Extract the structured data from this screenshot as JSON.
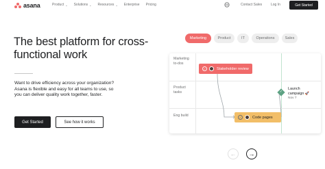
{
  "nav": {
    "logo_text": "asana",
    "links": [
      {
        "label": "Product",
        "has_dropdown": true
      },
      {
        "label": "Solutions",
        "has_dropdown": true
      },
      {
        "label": "Resources",
        "has_dropdown": true
      },
      {
        "label": "Enterprise",
        "has_dropdown": false
      },
      {
        "label": "Pricing",
        "has_dropdown": false
      }
    ],
    "globe_icon": "globe-icon",
    "contact_sales": "Contact Sales",
    "log_in": "Log In",
    "get_started": "Get Started"
  },
  "hero": {
    "headline": "The best platform for cross-functional work",
    "description": "Want to drive efficiency across your organization? Asana is flexible and easy for all teams to use, so you can deliver quality work together, faster.",
    "primary_cta": "Get Started",
    "secondary_cta": "See how it works"
  },
  "tabs": [
    {
      "label": "Marketing",
      "active": true
    },
    {
      "label": "Product",
      "active": false
    },
    {
      "label": "IT",
      "active": false
    },
    {
      "label": "Operations",
      "active": false
    },
    {
      "label": "Sales",
      "active": false
    }
  ],
  "board": {
    "rows": [
      {
        "label": "Marketing\nto-dos"
      },
      {
        "label": "Product\ntasks"
      },
      {
        "label": "Eng build"
      }
    ],
    "tasks": [
      {
        "title": "Stakeholder review",
        "color": "#f06a6a"
      },
      {
        "title": "Code pages",
        "color": "#f2be68"
      }
    ],
    "milestone": {
      "title": "Launch campaign",
      "date": "Nov 7",
      "icon": "rocket-icon",
      "color": "#5da283"
    }
  },
  "carousel": {
    "prev_icon": "arrow-left-icon",
    "next_icon": "arrow-right-icon"
  },
  "colors": {
    "brand_coral": "#f06a6a",
    "dark": "#1e1f21",
    "milestone_green": "#5da283",
    "task_yellow": "#f2be68"
  }
}
